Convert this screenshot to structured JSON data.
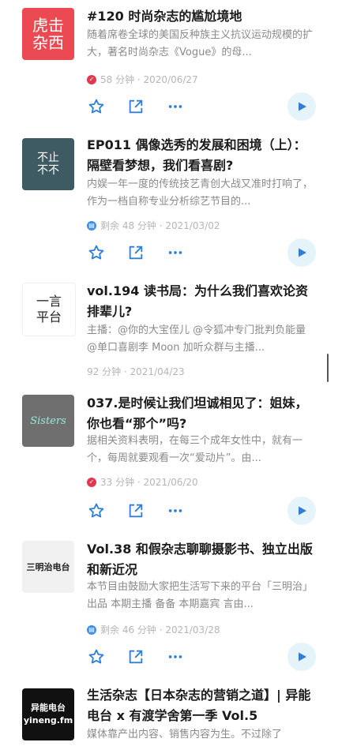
{
  "colors": {
    "accent": "#2e7fd6",
    "play_bg": "#e5f3fb",
    "title": "#1b1b1b",
    "desc": "#8a8a8a",
    "meta": "#b5b5b5",
    "played_badge": "#e0384f",
    "remaining_badge": "#3f8fe6"
  },
  "action_icons": [
    "star-icon",
    "share-icon",
    "more-icon",
    "play-icon"
  ],
  "episodes": [
    {
      "cover_text": "虎击\n杂西",
      "title": "#120 时尚杂志的尴尬境地",
      "description": "随着席卷全球的美国反种族主义抗议运动规模的扩大，著名时尚杂志《Vogue》的母...",
      "status_icon": "played-check-icon",
      "meta": "58 分钟 · 2020/06/27"
    },
    {
      "cover_text": "不止\n不不",
      "title": "EP011 偶像选秀的发展和困境（上）：隔壁看梦想，我们看喜剧?",
      "description": "内娱一年一度的传统技艺青创大战又准时打响了，作为一档自称专业分析综艺节目的...",
      "status_icon": "remaining-icon",
      "meta": "剩余 48 分钟 · 2021/03/02"
    },
    {
      "cover_text": "一言\n平台",
      "title": "vol.194 读书局：为什么我们喜欢论资排辈儿?",
      "description": "主播：@你的大宝侄儿 @令狐冲专门批判负能量 @单口喜剧李 Moon 加听众群与主播...",
      "status_icon": "",
      "meta": "92 分钟 · 2021/04/23"
    },
    {
      "cover_text": "Sisters",
      "title": "037.是时候让我们坦诚相见了：姐妹，你也看“那个”吗?",
      "description": "据相关资料表明，在每三个成年女性中，就有一个，每周就要观看一次“爱动片”。由...",
      "status_icon": "played-check-icon",
      "meta": "33 分钟 · 2021/06/20"
    },
    {
      "cover_text": "三明治电台",
      "title": "Vol.38 和假杂志聊聊摄影书、独立出版和新近况",
      "description": "本节目由鼓励大家把生活写下来的平台「三明治」出品 本期主播 备备 本期嘉宾 言由...",
      "status_icon": "remaining-icon",
      "meta": "剩余 46 分钟 · 2021/03/28"
    },
    {
      "cover_text": "异能电台\nyineng.fm",
      "title": "生活杂志【日本杂志的营销之道】| 异能电台 x 有渡学舍第一季 Vol.5",
      "description": "媒体靠产出内容、销售内容为生。不过除了",
      "status_icon": "",
      "meta": ""
    }
  ]
}
